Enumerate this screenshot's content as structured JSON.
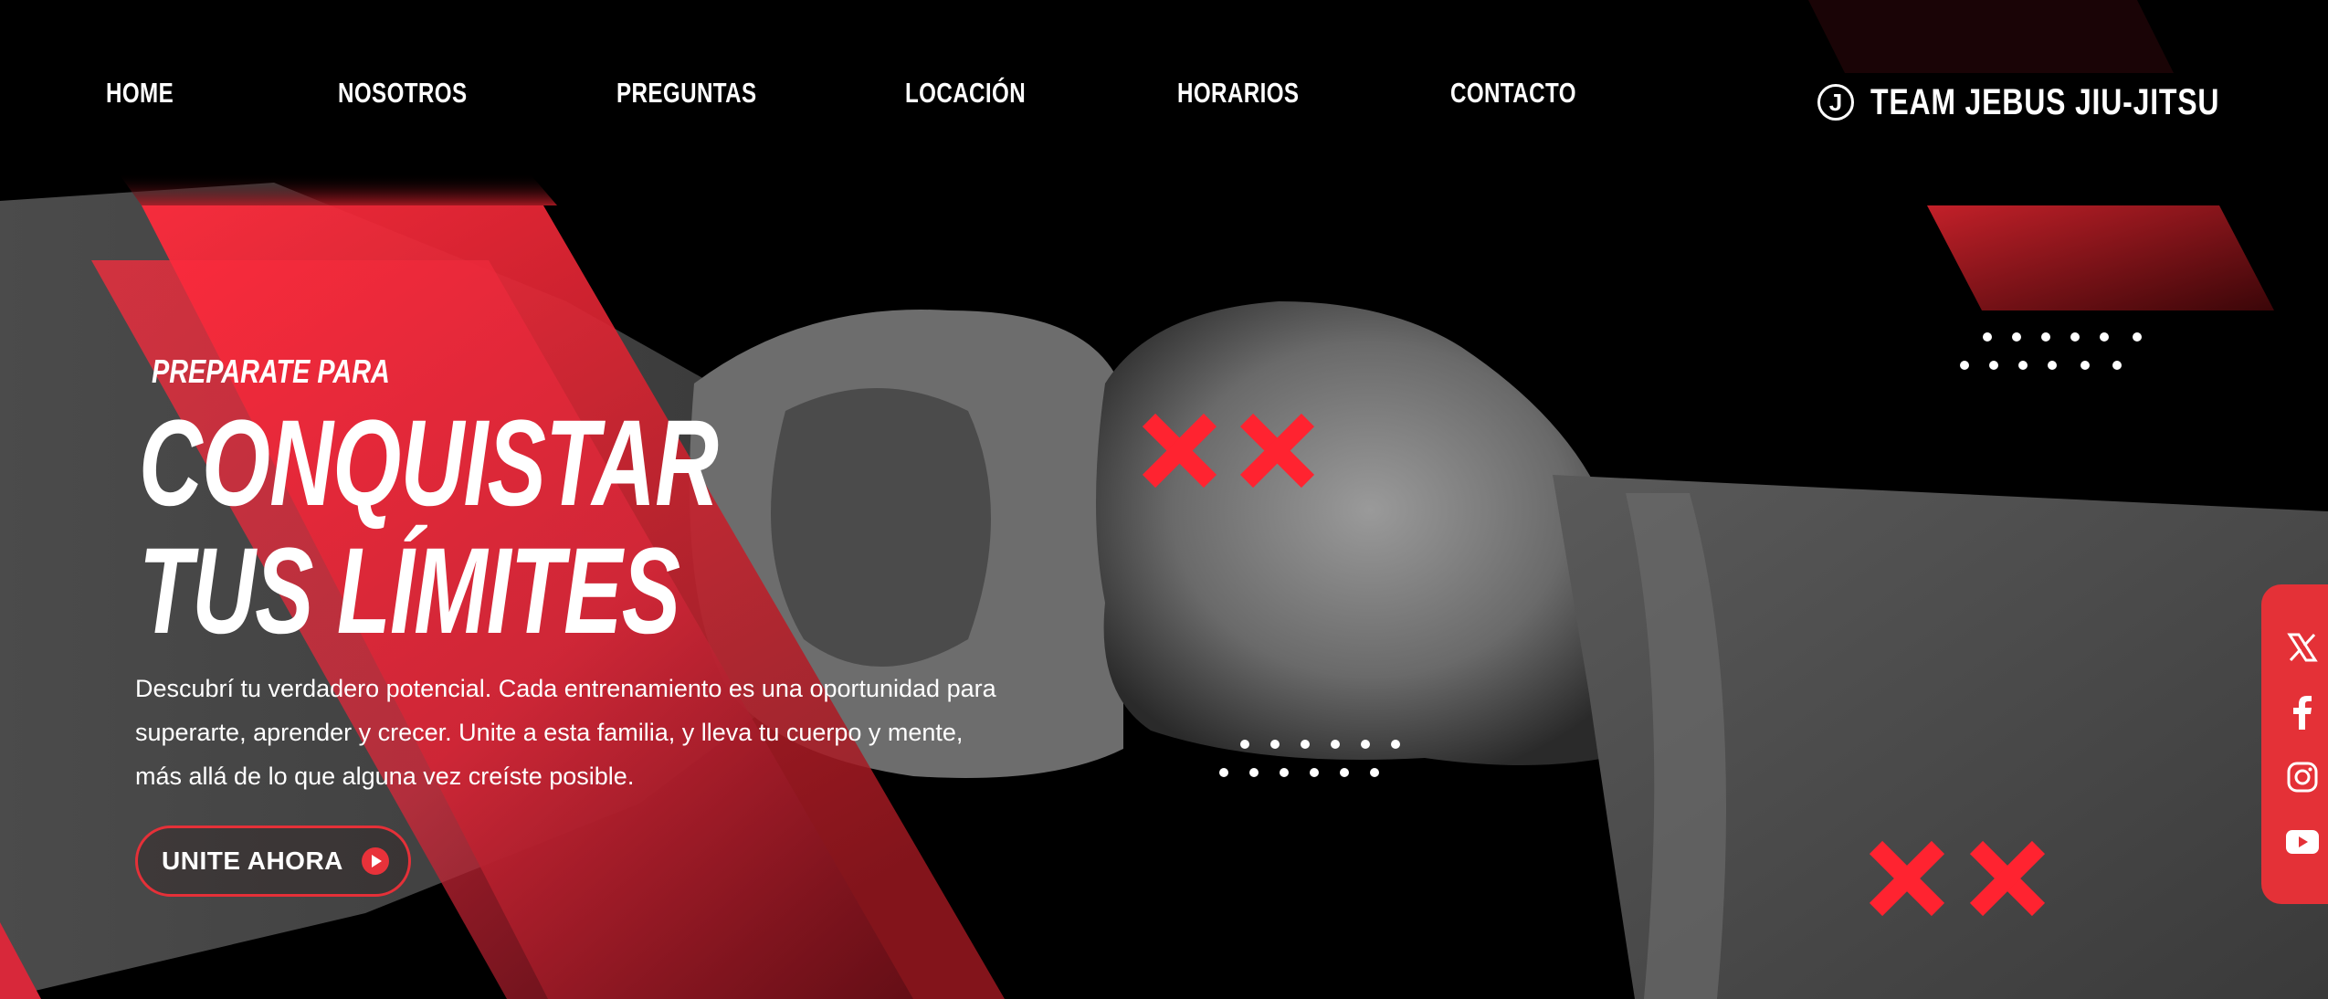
{
  "nav": {
    "items": [
      {
        "label": "HOME"
      },
      {
        "label": "NOSOTROS"
      },
      {
        "label": "PREGUNTAS"
      },
      {
        "label": "LOCACIÓN"
      },
      {
        "label": "HORARIOS"
      },
      {
        "label": "CONTACTO"
      }
    ]
  },
  "brand": {
    "logo_letter": "J",
    "name": "TEAM JEBUS JIU-JITSU"
  },
  "hero": {
    "kicker": "PREPARATE PARA",
    "headline_line1": "CONQUISTAR",
    "headline_line2": "TUS LÍMITES",
    "description": "Descubrí tu verdadero potencial. Cada entrenamiento es una oportunidad para superarte, aprender y crecer. Unite a esta familia, y lleva tu cuerpo y mente, más allá de lo que alguna vez creíste posible.",
    "cta_label": "UNITE AHORA"
  },
  "social": {
    "items": [
      {
        "icon": "x-icon"
      },
      {
        "icon": "facebook-icon"
      },
      {
        "icon": "instagram-icon"
      },
      {
        "icon": "youtube-icon"
      }
    ]
  },
  "colors": {
    "accent": "#e8323a",
    "background": "#000000",
    "text": "#ffffff"
  }
}
